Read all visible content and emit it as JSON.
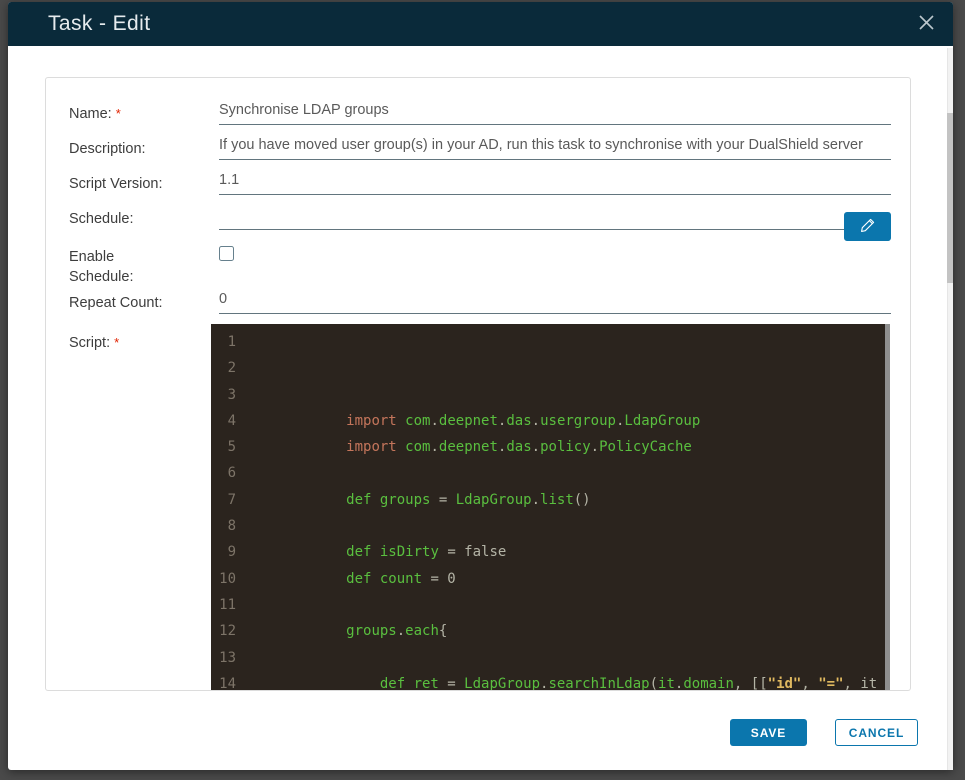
{
  "dialog": {
    "title": "Task - Edit",
    "close_icon": "x-icon"
  },
  "colors": {
    "accent_blue": "#0b76ad",
    "header_bg": "#0a2a3a",
    "backdrop": "#4a4a4a",
    "required_red": "#e12200",
    "editor_bg": "#2b241e",
    "token_green": "#5abf3f",
    "token_orange": "#c4755b",
    "token_gold": "#e0b960",
    "token_gray": "#b4b4a6",
    "line_number_gray": "#7d7468"
  },
  "form": {
    "name": {
      "label": "Name:",
      "required_mark": "*",
      "value": "Synchronise LDAP groups"
    },
    "description": {
      "label": "Description:",
      "value": "If you have moved user group(s) in your AD, run this task to synchronise with your DualShield server"
    },
    "script_version": {
      "label": "Script Version:",
      "value": "1.1"
    },
    "schedule": {
      "label": "Schedule:",
      "value": "",
      "edit_icon": "pencil-icon"
    },
    "enable_schedule": {
      "label": "Enable Schedule:",
      "checked": false
    },
    "repeat_count": {
      "label": "Repeat Count:",
      "value": "0"
    },
    "script": {
      "label": "Script:",
      "required_mark": "*"
    }
  },
  "footer": {
    "save_label": "SAVE",
    "cancel_label": "CANCEL"
  },
  "editor": {
    "lines": [
      {
        "n": "1",
        "seg": []
      },
      {
        "n": "2",
        "seg": []
      },
      {
        "n": "3",
        "seg": []
      },
      {
        "n": "4",
        "seg": [
          {
            "c": "w",
            "t": "            "
          },
          {
            "c": "k",
            "t": "import"
          },
          {
            "c": "w",
            "t": " "
          },
          {
            "c": "g",
            "t": "com"
          },
          {
            "c": "p",
            "t": "."
          },
          {
            "c": "g",
            "t": "deepnet"
          },
          {
            "c": "p",
            "t": "."
          },
          {
            "c": "g",
            "t": "das"
          },
          {
            "c": "p",
            "t": "."
          },
          {
            "c": "g",
            "t": "usergroup"
          },
          {
            "c": "p",
            "t": "."
          },
          {
            "c": "g",
            "t": "LdapGroup"
          }
        ]
      },
      {
        "n": "5",
        "seg": [
          {
            "c": "w",
            "t": "            "
          },
          {
            "c": "k",
            "t": "import"
          },
          {
            "c": "w",
            "t": " "
          },
          {
            "c": "g",
            "t": "com"
          },
          {
            "c": "p",
            "t": "."
          },
          {
            "c": "g",
            "t": "deepnet"
          },
          {
            "c": "p",
            "t": "."
          },
          {
            "c": "g",
            "t": "das"
          },
          {
            "c": "p",
            "t": "."
          },
          {
            "c": "g",
            "t": "policy"
          },
          {
            "c": "p",
            "t": "."
          },
          {
            "c": "g",
            "t": "PolicyCache"
          }
        ]
      },
      {
        "n": "6",
        "seg": []
      },
      {
        "n": "7",
        "seg": [
          {
            "c": "w",
            "t": "            "
          },
          {
            "c": "g",
            "t": "def groups "
          },
          {
            "c": "p",
            "t": "= "
          },
          {
            "c": "g",
            "t": "LdapGroup"
          },
          {
            "c": "p",
            "t": "."
          },
          {
            "c": "g",
            "t": "list"
          },
          {
            "c": "p",
            "t": "()"
          }
        ]
      },
      {
        "n": "8",
        "seg": []
      },
      {
        "n": "9",
        "seg": [
          {
            "c": "w",
            "t": "            "
          },
          {
            "c": "g",
            "t": "def isDirty "
          },
          {
            "c": "p",
            "t": "= false"
          }
        ]
      },
      {
        "n": "10",
        "seg": [
          {
            "c": "w",
            "t": "            "
          },
          {
            "c": "g",
            "t": "def count "
          },
          {
            "c": "p",
            "t": "= 0"
          }
        ]
      },
      {
        "n": "11",
        "seg": []
      },
      {
        "n": "12",
        "seg": [
          {
            "c": "w",
            "t": "            "
          },
          {
            "c": "g",
            "t": "groups"
          },
          {
            "c": "p",
            "t": "."
          },
          {
            "c": "g",
            "t": "each"
          },
          {
            "c": "p",
            "t": "{"
          }
        ]
      },
      {
        "n": "13",
        "seg": []
      },
      {
        "n": "14",
        "seg": [
          {
            "c": "w",
            "t": "                "
          },
          {
            "c": "g",
            "t": "def ret "
          },
          {
            "c": "p",
            "t": "= "
          },
          {
            "c": "g",
            "t": "LdapGroup"
          },
          {
            "c": "p",
            "t": "."
          },
          {
            "c": "g",
            "t": "searchInLdap"
          },
          {
            "c": "p",
            "t": "("
          },
          {
            "c": "g",
            "t": "it"
          },
          {
            "c": "p",
            "t": "."
          },
          {
            "c": "g",
            "t": "domain"
          },
          {
            "c": "p",
            "t": ", [["
          },
          {
            "c": "s",
            "t": "\"id\""
          },
          {
            "c": "p",
            "t": ", "
          },
          {
            "c": "s",
            "t": "\"=\""
          },
          {
            "c": "p",
            "t": ", it"
          }
        ]
      }
    ]
  }
}
